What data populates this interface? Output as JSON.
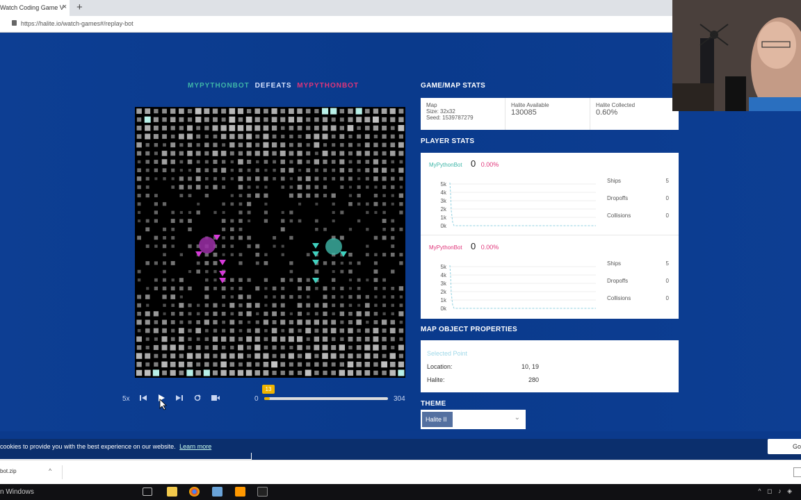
{
  "browser": {
    "tab_title": "Watch Coding Game V",
    "close_glyph": "×",
    "new_tab_glyph": "+",
    "url": "https://halite.io/watch-games#/replay-bot"
  },
  "matchup": {
    "winner": "MYPYTHONBOT",
    "verb": "DEFEATS",
    "loser": "MYPYTHONBOT"
  },
  "controls": {
    "speed": "5x",
    "start_turn": "0",
    "end_turn": "304",
    "current_turn": "13",
    "progress": 0.043
  },
  "game_map_stats": {
    "title": "GAME/MAP STATS",
    "map_label": "Map",
    "map_size": "Size: 32x32",
    "map_seed": "Seed: 1539787279",
    "halite_available_label": "Halite Available",
    "halite_available": "130085",
    "halite_collected_label": "Halite Collected",
    "halite_collected": "0.60%"
  },
  "player_stats": {
    "title": "PLAYER STATS",
    "players": [
      {
        "name": "MyPythonBot",
        "score": "0",
        "pct": "0.00%",
        "color": "#3fb6a8",
        "y_ticks": [
          "5k",
          "4k",
          "3k",
          "2k",
          "1k",
          "0k"
        ],
        "ships_label": "Ships",
        "ships": "5",
        "dropoffs_label": "Dropoffs",
        "dropoffs": "0",
        "collisions_label": "Collisions",
        "collisions": "0"
      },
      {
        "name": "MyPythonBot",
        "score": "0",
        "pct": "0.00%",
        "color": "#e0357a",
        "y_ticks": [
          "5k",
          "4k",
          "3k",
          "2k",
          "1k",
          "0k"
        ],
        "ships_label": "Ships",
        "ships": "5",
        "dropoffs_label": "Dropoffs",
        "dropoffs": "0",
        "collisions_label": "Collisions",
        "collisions": "0"
      }
    ]
  },
  "map_object": {
    "title": "MAP OBJECT PROPERTIES",
    "selected_label": "Selected Point",
    "location_label": "Location:",
    "location": "10, 19",
    "halite_label": "Halite:",
    "halite": "280"
  },
  "theme": {
    "title": "THEME",
    "selected": "Halite II"
  },
  "cookie": {
    "text": "cookies to provide you with the best experience on our website.",
    "learn_more": "Learn more",
    "got_it": "Got"
  },
  "downloads": {
    "file": "bot.zip",
    "chevron": "^"
  },
  "taskbar": {
    "search_text": "n Windows"
  },
  "colors": {
    "accent_green": "#3fb6a8",
    "accent_red": "#e0357a",
    "progress": "#f0b400",
    "page_bg": "#0b3a8c"
  }
}
